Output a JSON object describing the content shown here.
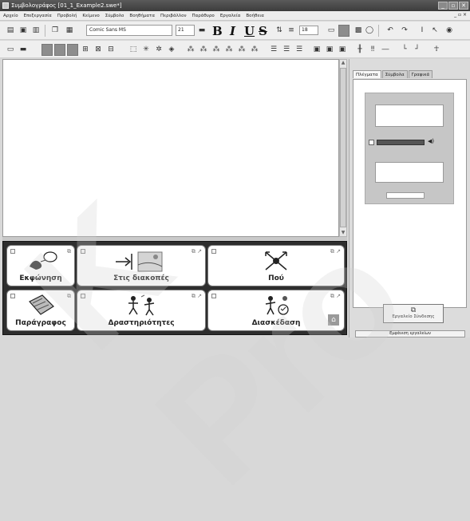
{
  "window": {
    "title": "Συμβολογράφος  [01_1_Example2.swe*]",
    "buttons": [
      "_",
      "▫",
      "✕"
    ]
  },
  "menu": {
    "items": [
      "Αρχείο",
      "Επεξεργασία",
      "Προβολή",
      "Κείμενο",
      "Σύμβολο",
      "Βοηθήματα",
      "Περιβάλλον",
      "Παράθυρο",
      "Εργαλεία",
      "Βοήθεια"
    ],
    "mdi_controls": "_ ▫ ×"
  },
  "format_toolbar": {
    "font": "Comic Sans MS",
    "font_size": "21",
    "bold": "B",
    "italic": "I",
    "underline": "U",
    "strike": "S",
    "symbol_size": "18"
  },
  "grid_cells": [
    {
      "label": "Εκφώνηση",
      "picture": "speech-bubble-icon"
    },
    {
      "label": "Στις διακοπές",
      "picture": "holiday-picture"
    },
    {
      "label": "Πού",
      "picture": "where-arrows-icon"
    },
    {
      "label": "Παράγραφος",
      "picture": "paragraph-icon"
    },
    {
      "label": "Δραστηριότητες",
      "picture": "activities-picture"
    },
    {
      "label": "Διασκέδαση",
      "picture": "fun-picture"
    }
  ],
  "panel": {
    "tabs": [
      "Πλέγματα",
      "Σύμβολα",
      "Γραφικά"
    ],
    "active_tab": 0,
    "connect_button": "Εργαλείο Σύνδεσης",
    "tools_button": "Εμφάνιση εργαλείων"
  },
  "colors": {
    "titlebar": "#4a4a4a",
    "grid_background": "#2e2e2e",
    "toolbar": "#efefef"
  }
}
